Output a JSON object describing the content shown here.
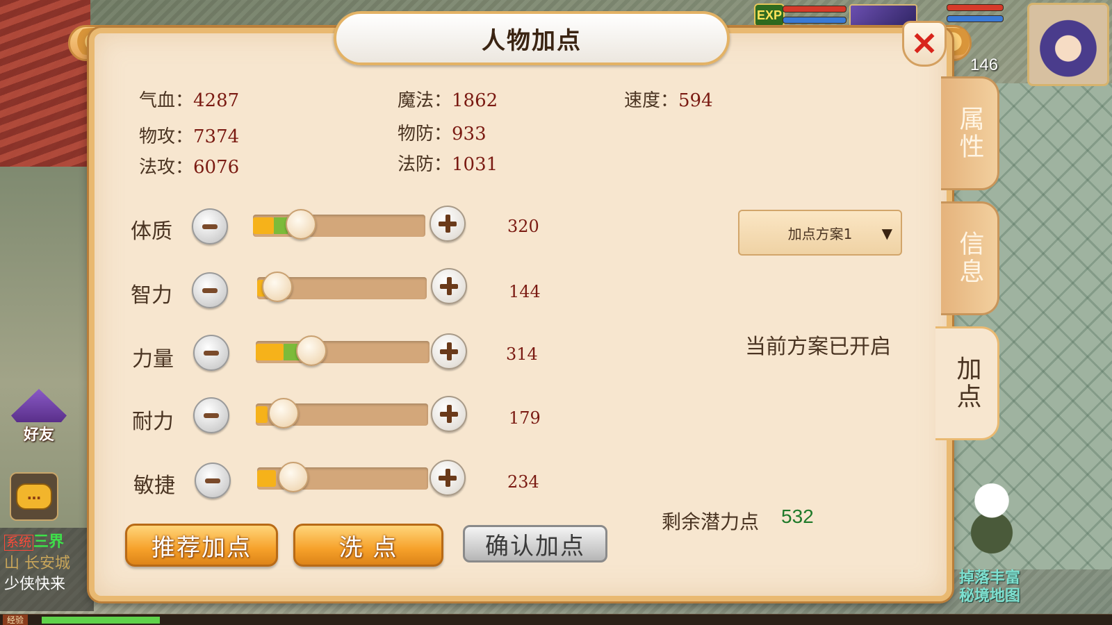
{
  "title": "人物加点",
  "close_icon": "close-x-icon",
  "stats": {
    "hp": {
      "label": "气血：",
      "value": "4287"
    },
    "mp": {
      "label": "魔法：",
      "value": "1862"
    },
    "speed": {
      "label": "速度：",
      "value": "594"
    },
    "patk": {
      "label": "物攻：",
      "value": "7374"
    },
    "pdef": {
      "label": "物防：",
      "value": "933"
    },
    "matk": {
      "label": "法攻：",
      "value": "6076"
    },
    "mdef": {
      "label": "法防：",
      "value": "1031"
    }
  },
  "attributes": [
    {
      "label": "体质",
      "value": "320",
      "fill": 0.12,
      "bonus": 0.08,
      "knob": 0.28
    },
    {
      "label": "智力",
      "value": "144",
      "fill": 0.05,
      "bonus": 0.0,
      "knob": 0.12
    },
    {
      "label": "力量",
      "value": "314",
      "fill": 0.16,
      "bonus": 0.1,
      "knob": 0.32
    },
    {
      "label": "耐力",
      "value": "179",
      "fill": 0.07,
      "bonus": 0.0,
      "knob": 0.16
    },
    {
      "label": "敏捷",
      "value": "234",
      "fill": 0.11,
      "bonus": 0.0,
      "knob": 0.21
    }
  ],
  "plan": {
    "selected": "加点方案1",
    "caret": "▼",
    "status": "当前方案已开启"
  },
  "remaining": {
    "label": "剩余潜力点",
    "value": "532"
  },
  "tabs": [
    {
      "label": "属性",
      "active": false
    },
    {
      "label": "信息",
      "active": false
    },
    {
      "label": "加点",
      "active": true
    }
  ],
  "buttons": {
    "recommend": "推荐加点",
    "reset": "洗 点",
    "confirm": "确认加点"
  },
  "hud": {
    "exp_badge": "EXP",
    "level": "146",
    "friends": "好友",
    "chat_icon": "…",
    "exp_label": "经验",
    "chat": {
      "tag": "系统",
      "channel": "三界",
      "line2": "山 长安城",
      "line3": "少侠快来"
    },
    "map_hint": [
      "掉落丰富",
      "秘境地图"
    ]
  },
  "colors": {
    "accent": "#f6a12a",
    "value_red": "#7a1a12",
    "remaining_green": "#1f7a2a",
    "slider_fill": "#f6b21a",
    "slider_bonus": "#7cbb3a"
  }
}
